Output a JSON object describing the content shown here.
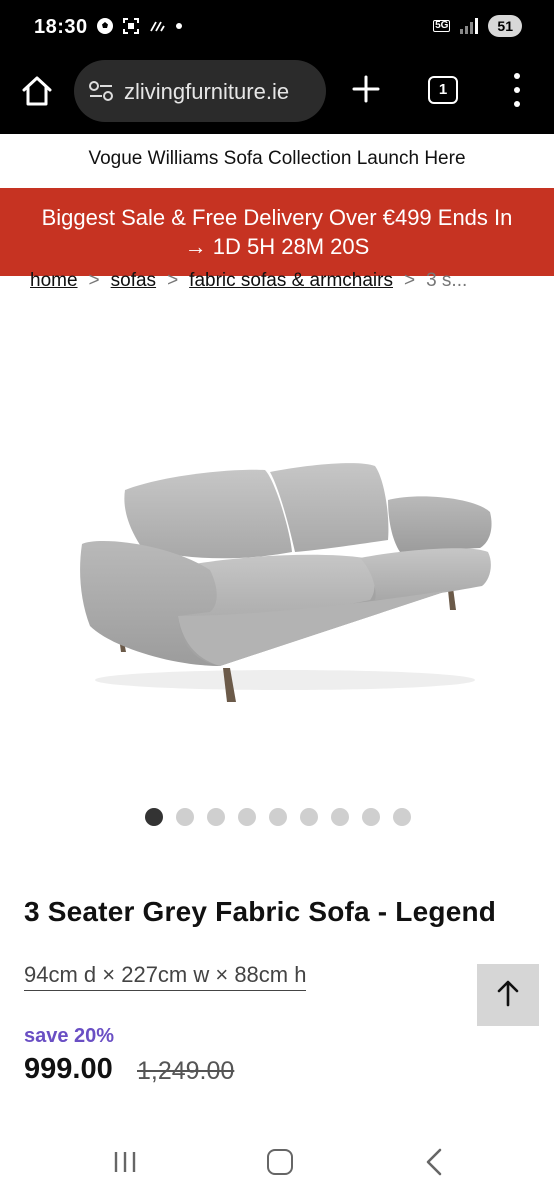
{
  "status_bar": {
    "time": "18:30",
    "network_label": "5G",
    "battery": "51"
  },
  "browser": {
    "url": "zlivingfurniture.ie",
    "tab_count": "1"
  },
  "announcement": "Vogue Williams Sofa Collection Launch Here",
  "sale_banner": {
    "line1": "Biggest Sale & Free Delivery Over €499 Ends In",
    "line2": "→ 1D 5H 28M 20S"
  },
  "breadcrumb": {
    "items": [
      "home",
      "sofas",
      "fabric sofas & armchairs"
    ],
    "current": "3 s...",
    "separator": ">"
  },
  "carousel": {
    "total": 9,
    "active_index": 0
  },
  "product": {
    "title": "3 Seater Grey Fabric Sofa - Legend",
    "dimensions": "94cm d × 227cm w × 88cm h",
    "save_label": "save 20%",
    "price": "999.00",
    "old_price": "1,249.00"
  },
  "colors": {
    "sale_banner": "#c63322",
    "save_text": "#6a4fc4",
    "browser_bar": "#000000"
  },
  "icons": {
    "home": "home-icon",
    "site_settings": "tune-icon",
    "new_tab": "plus-icon",
    "tabs": "tab-switcher-icon",
    "menu": "more-vert-icon",
    "scroll_top": "arrow-up-icon",
    "nav_recent": "recent-apps-icon",
    "nav_home": "nav-home-icon",
    "nav_back": "chevron-left-icon"
  }
}
